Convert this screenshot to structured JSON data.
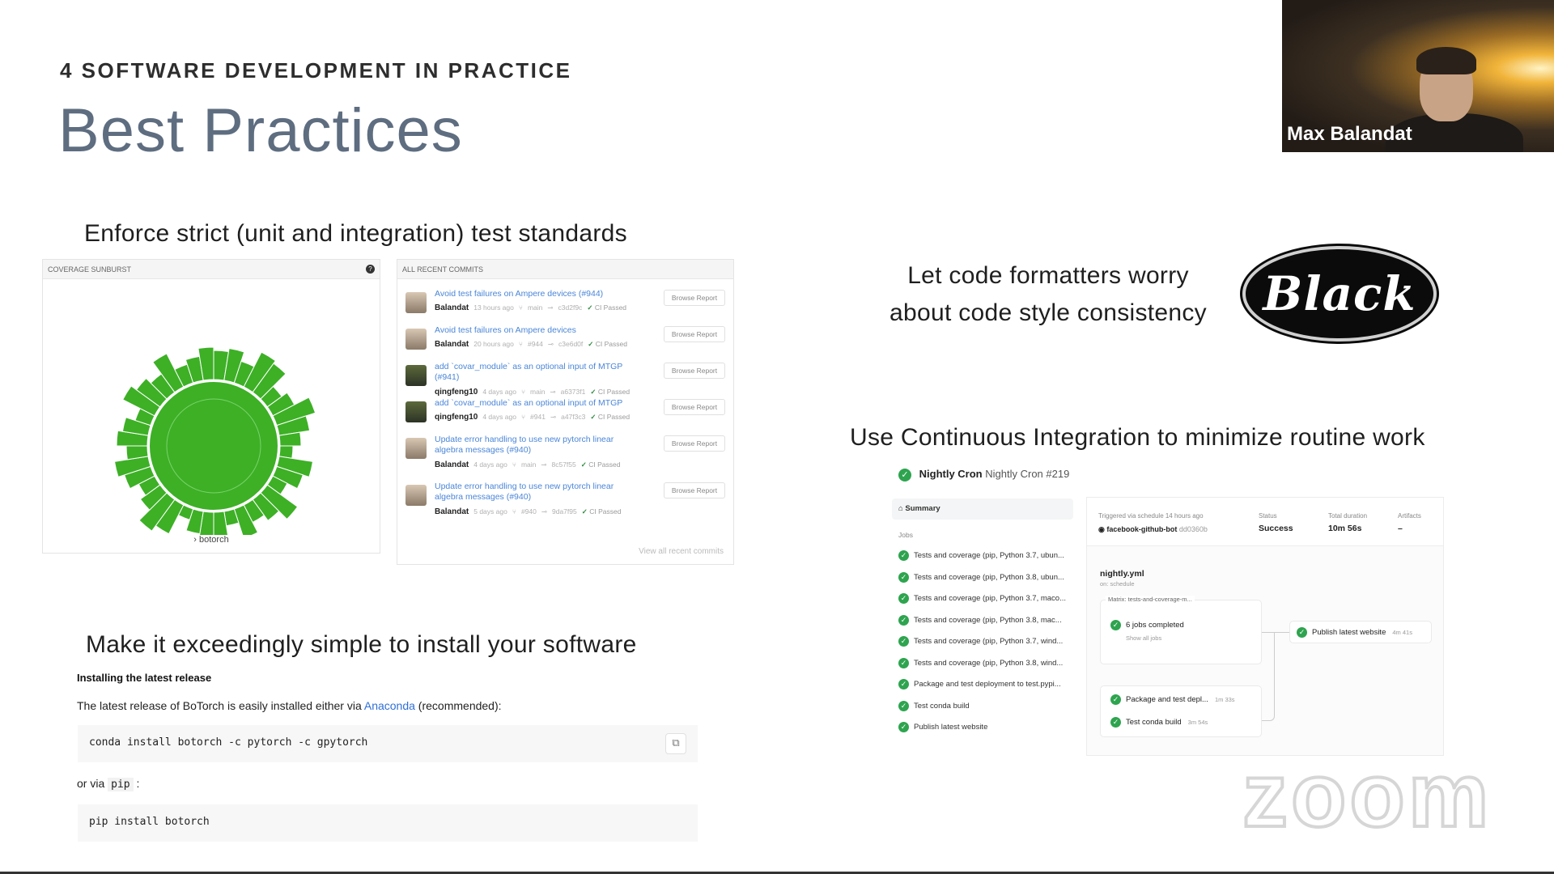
{
  "slide": {
    "section_label": "4  SOFTWARE DEVELOPMENT IN PRACTICE",
    "title": "Best Practices"
  },
  "webcam": {
    "participant_name": "Max Balandat"
  },
  "test_section": {
    "heading": "Enforce strict (unit and integration) test standards",
    "coverage": {
      "header": "COVERAGE SUNBURST",
      "caption": "botorch",
      "color": "#3db026"
    },
    "commits": {
      "header": "ALL RECENT COMMITS",
      "view_all": "View all recent commits",
      "browse_label": "Browse Report",
      "items": [
        {
          "message": "Avoid test failures on Ampere devices (#944)",
          "author": "Balandat",
          "time": "13 hours ago",
          "branch": "main",
          "sha": "c3d2f9c",
          "status": "CI Passed"
        },
        {
          "message": "Avoid test failures on Ampere devices",
          "author": "Balandat",
          "time": "20 hours ago",
          "branch": "#944",
          "sha": "c3e6d0f",
          "status": "CI Passed"
        },
        {
          "message": "add `covar_module` as an optional input of MTGP (#941)",
          "author": "qingfeng10",
          "time": "4 days ago",
          "branch": "main",
          "sha": "a6373f1",
          "status": "CI Passed"
        },
        {
          "message": "add `covar_module` as an optional input of MTGP",
          "author": "qingfeng10",
          "time": "4 days ago",
          "branch": "#941",
          "sha": "a47f3c3",
          "status": "CI Passed"
        },
        {
          "message": "Update error handling to use new pytorch linear algebra messages (#940)",
          "author": "Balandat",
          "time": "4 days ago",
          "branch": "main",
          "sha": "8c57f55",
          "status": "CI Passed"
        },
        {
          "message": "Update error handling to use new pytorch linear algebra messages (#940)",
          "author": "Balandat",
          "time": "5 days ago",
          "branch": "#940",
          "sha": "9da7f95",
          "status": "CI Passed"
        }
      ]
    }
  },
  "formatter_section": {
    "line1": "Let code formatters worry",
    "line2": "about code style consistency",
    "logo_text": "Black"
  },
  "install_section": {
    "heading": "Make it exceedingly simple to install your software",
    "subheading": "Installing the latest release",
    "text_before": "The latest release of BoTorch is easily installed either via ",
    "link_text": "Anaconda",
    "text_after": " (recommended):",
    "conda_cmd": "conda install botorch -c pytorch -c gpytorch",
    "or_text": "or via ",
    "pip_word": "pip",
    "or_colon": " :",
    "pip_cmd": "pip install botorch"
  },
  "ci_section": {
    "heading": "Use Continuous Integration to minimize routine work",
    "workflow_name": "Nightly Cron",
    "run_name": "Nightly Cron #219",
    "summary": "Summary",
    "jobs_label": "Jobs",
    "jobs": [
      "Tests and coverage (pip, Python 3.7, ubun...",
      "Tests and coverage (pip, Python 3.8, ubun...",
      "Tests and coverage (pip, Python 3.7, maco...",
      "Tests and coverage (pip, Python 3.8, mac...",
      "Tests and coverage (pip, Python 3.7, wind...",
      "Tests and coverage (pip, Python 3.8, wind...",
      "Package and test deployment to test.pypi...",
      "Test conda build",
      "Publish latest website"
    ],
    "trigger_label": "Triggered via schedule 14 hours ago",
    "trigger_actor": "facebook-github-bot",
    "trigger_sha": "dd0360b",
    "status_label": "Status",
    "status_value": "Success",
    "duration_label": "Total duration",
    "duration_value": "10m 56s",
    "artifacts_label": "Artifacts",
    "artifacts_value": "–",
    "yml_name": "nightly.yml",
    "yml_sub": "on: schedule",
    "matrix_label": "Matrix: tests-and-coverage-m...",
    "matrix_done": "6 jobs completed",
    "show_all": "Show all jobs",
    "publish_node": "Publish latest website",
    "publish_dur": "4m 41s",
    "pkg_node": "Package and test depl...",
    "pkg_dur": "1m 33s",
    "conda_node": "Test conda build",
    "conda_dur": "3m 54s"
  },
  "watermark": "zoom"
}
